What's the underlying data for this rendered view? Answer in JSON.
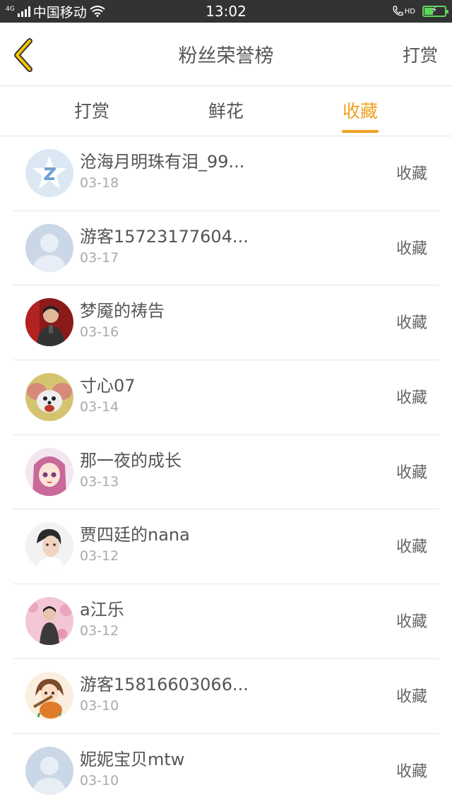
{
  "status_bar": {
    "network": "4G",
    "carrier": "中国移动",
    "time": "13:02",
    "hd_label": "HD"
  },
  "navbar": {
    "title": "粉丝荣誉榜",
    "right_label": "打赏",
    "accent_color": "#f0a020"
  },
  "tabs": [
    {
      "label": "打赏",
      "active": false
    },
    {
      "label": "鲜花",
      "active": false
    },
    {
      "label": "收藏",
      "active": true
    }
  ],
  "list": [
    {
      "name": "沧海月明珠有泪_99...",
      "date": "03-18",
      "action": "收藏",
      "avatar": "qq-star-icon"
    },
    {
      "name": "游客15723177604...",
      "date": "03-17",
      "action": "收藏",
      "avatar": "default-user-icon"
    },
    {
      "name": "梦魇的祷告",
      "date": "03-16",
      "action": "收藏",
      "avatar": "photo-man-red"
    },
    {
      "name": "寸心07",
      "date": "03-14",
      "action": "收藏",
      "avatar": "cartoon-mouse"
    },
    {
      "name": "那一夜的成长",
      "date": "03-13",
      "action": "收藏",
      "avatar": "anime-girl"
    },
    {
      "name": "贾四廷的nana",
      "date": "03-12",
      "action": "收藏",
      "avatar": "photo-portrait"
    },
    {
      "name": "a江乐",
      "date": "03-12",
      "action": "收藏",
      "avatar": "photo-pink"
    },
    {
      "name": "游客15816603066...",
      "date": "03-10",
      "action": "收藏",
      "avatar": "cartoon-girl-guitar"
    },
    {
      "name": "妮妮宝贝mtw",
      "date": "03-10",
      "action": "收藏",
      "avatar": "default-user-icon"
    }
  ]
}
